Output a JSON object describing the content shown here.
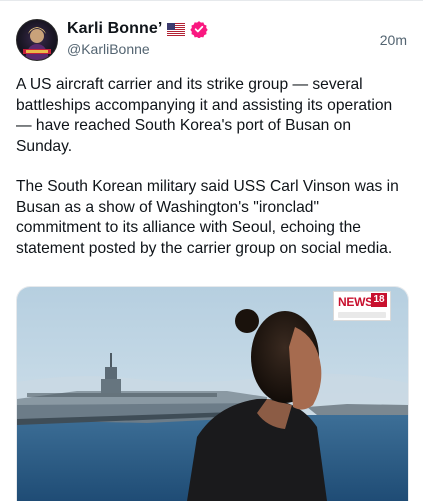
{
  "post": {
    "author": {
      "display_name": "Karli Bonne’",
      "handle": "@KarliBonne",
      "flag_icon": "us-flag-icon",
      "verified_icon": "verified-badge-icon",
      "verified_color": "#f91880"
    },
    "timestamp": "20m",
    "paragraphs": [
      "A US aircraft carrier and its strike group — several battleships accompanying it and assisting its operation — have reached South Korea's port of Busan on Sunday.",
      "The South Korean military said USS Carl Vinson was in Busan as a show of Washington's \"ironclad\" commitment to its alliance with Seoul, echoing the statement posted by the carrier group on social media."
    ],
    "media": {
      "type": "video-thumbnail",
      "logo_text": "NEWS",
      "logo_number": "18"
    }
  }
}
